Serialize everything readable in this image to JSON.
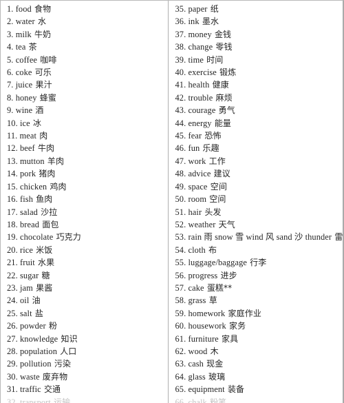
{
  "document": {
    "type": "vocabulary-list",
    "layout": "two-column",
    "divider": true,
    "columns": [
      {
        "name": "left-column",
        "entries": [
          {
            "num": "1.",
            "term": "food",
            "gloss": "食物"
          },
          {
            "num": "2.",
            "term": "water",
            "gloss": "水"
          },
          {
            "num": "3.",
            "term": "milk",
            "gloss": "牛奶"
          },
          {
            "num": "4.",
            "term": "tea",
            "gloss": "茶"
          },
          {
            "num": "5.",
            "term": "coffee",
            "gloss": "咖啡"
          },
          {
            "num": "6.",
            "term": "coke",
            "gloss": "可乐"
          },
          {
            "num": "7.",
            "term": "juice",
            "gloss": "果汁"
          },
          {
            "num": "8.",
            "term": "honey",
            "gloss": "蜂蜜"
          },
          {
            "num": "9.",
            "term": "wine",
            "gloss": "酒"
          },
          {
            "num": "10.",
            "term": "ice",
            "gloss": "冰"
          },
          {
            "num": "11.",
            "term": "meat",
            "gloss": "肉"
          },
          {
            "num": "12.",
            "term": "beef",
            "gloss": "牛肉"
          },
          {
            "num": "13.",
            "term": "mutton",
            "gloss": "羊肉"
          },
          {
            "num": "14.",
            "term": "pork",
            "gloss": "猪肉"
          },
          {
            "num": "15.",
            "term": "chicken",
            "gloss": "鸡肉"
          },
          {
            "num": "16.",
            "term": "fish",
            "gloss": "鱼肉"
          },
          {
            "num": "17.",
            "term": "salad",
            "gloss": "沙拉"
          },
          {
            "num": "18.",
            "term": "bread",
            "gloss": "面包"
          },
          {
            "num": "19.",
            "term": "chocolate",
            "gloss": "巧克力"
          },
          {
            "num": "20.",
            "term": "rice",
            "gloss": "米饭"
          },
          {
            "num": "21.",
            "term": "fruit",
            "gloss": "水果"
          },
          {
            "num": "22.",
            "term": "sugar",
            "gloss": "糖"
          },
          {
            "num": "23.",
            "term": "jam",
            "gloss": "果酱"
          },
          {
            "num": "24.",
            "term": "oil",
            "gloss": "油"
          },
          {
            "num": "25.",
            "term": "salt",
            "gloss": "盐"
          },
          {
            "num": "26.",
            "term": "powder",
            "gloss": "粉"
          },
          {
            "num": "27.",
            "term": "knowledge",
            "gloss": "知识"
          },
          {
            "num": "28.",
            "term": "population",
            "gloss": "人口"
          },
          {
            "num": "29.",
            "term": "pollution",
            "gloss": "污染"
          },
          {
            "num": "30.",
            "term": "waste",
            "gloss": "废弃物"
          },
          {
            "num": "31.",
            "term": "traffic",
            "gloss": "交通"
          },
          {
            "num": "32.",
            "term": "transport",
            "gloss": "运输",
            "cropped": true
          }
        ]
      },
      {
        "name": "right-column",
        "entries": [
          {
            "num": "35.",
            "term": "paper",
            "gloss": "纸"
          },
          {
            "num": "36.",
            "term": "ink",
            "gloss": "墨水"
          },
          {
            "num": "37.",
            "term": "money",
            "gloss": "金钱"
          },
          {
            "num": "38.",
            "term": "change",
            "gloss": "零钱"
          },
          {
            "num": "39.",
            "term": "time",
            "gloss": "时间"
          },
          {
            "num": "40.",
            "term": "exercise",
            "gloss": "锻炼"
          },
          {
            "num": "41.",
            "term": "health",
            "gloss": "健康"
          },
          {
            "num": "42.",
            "term": "trouble",
            "gloss": "麻烦"
          },
          {
            "num": "43.",
            "term": "courage",
            "gloss": "勇气"
          },
          {
            "num": "44.",
            "term": "energy",
            "gloss": "能量"
          },
          {
            "num": "45.",
            "term": "fear",
            "gloss": "恐怖"
          },
          {
            "num": "46.",
            "term": "fun",
            "gloss": "乐趣"
          },
          {
            "num": "47.",
            "term": "work",
            "gloss": "工作"
          },
          {
            "num": "48.",
            "term": "advice",
            "gloss": "建议"
          },
          {
            "num": "49.",
            "term": "space",
            "gloss": "空间"
          },
          {
            "num": "50.",
            "term": "room",
            "gloss": "空间"
          },
          {
            "num": "51.",
            "term": "hair",
            "gloss": "头发"
          },
          {
            "num": "52.",
            "term": "weather",
            "gloss": "天气"
          },
          {
            "num": "53.",
            "term": "rain 雨 snow 雪 wind 风 sand 沙 thunder",
            "gloss": "雷"
          },
          {
            "num": "54.",
            "term": "cloth",
            "gloss": "布"
          },
          {
            "num": "55.",
            "term": "luggage/baggage",
            "gloss": "行李"
          },
          {
            "num": "56.",
            "term": "progress",
            "gloss": "进步"
          },
          {
            "num": "57.",
            "term": "cake",
            "gloss": "蛋糕**"
          },
          {
            "num": "58.",
            "term": "grass",
            "gloss": "草"
          },
          {
            "num": "59.",
            "term": "homework",
            "gloss": "家庭作业"
          },
          {
            "num": "60.",
            "term": "housework",
            "gloss": "家务"
          },
          {
            "num": "61.",
            "term": "furniture",
            "gloss": "家具"
          },
          {
            "num": "62.",
            "term": "wood",
            "gloss": "木"
          },
          {
            "num": "63.",
            "term": "cash",
            "gloss": "现金"
          },
          {
            "num": "64.",
            "term": "glass",
            "gloss": "玻璃"
          },
          {
            "num": "65.",
            "term": "equipment",
            "gloss": "装备"
          },
          {
            "num": "66.",
            "term": "chalk",
            "gloss": "粉笔",
            "cropped": true
          }
        ]
      }
    ]
  }
}
